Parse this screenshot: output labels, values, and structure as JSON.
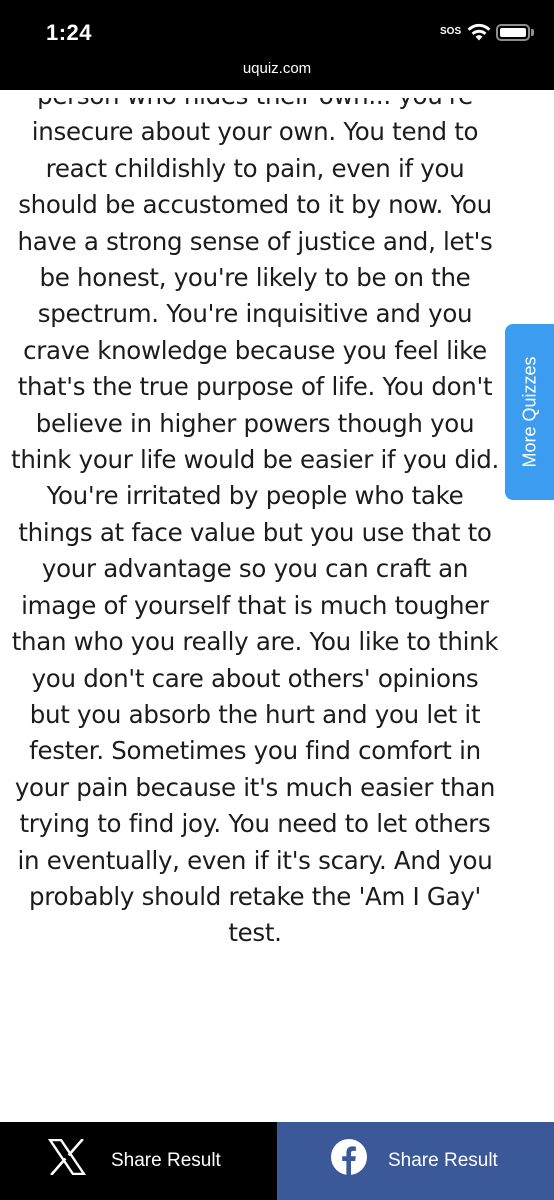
{
  "status_bar": {
    "time": "1:24",
    "sos": "SOS",
    "url": "uquiz.com"
  },
  "result": {
    "text": "person who hides their own... you're insecure about your own. You tend to react childishly to pain, even if you should be accustomed to it by now. You have a strong sense of justice and, let's be honest, you're likely to be on the spectrum. You're inquisitive and you crave knowledge because you feel like that's the true purpose of life. You don't believe in higher powers though you think your life would be easier if you did. You're irritated by people who take things at face value but you use that to your advantage so you can craft an image of yourself that is much tougher than who you really are. You like to think you don't care about others' opinions but you absorb the hurt and you let it fester. Sometimes you find comfort in your pain because it's much easier than trying to find joy. You need to let others in eventually, even if it's scary. And you probably should retake the 'Am I Gay' test."
  },
  "side_tab": {
    "label": "More Quizzes"
  },
  "share": {
    "x_label": "Share Result",
    "facebook_label": "Share Result"
  },
  "colors": {
    "side_tab": "#3c9cef",
    "facebook": "#3b5899",
    "x": "#000000"
  }
}
